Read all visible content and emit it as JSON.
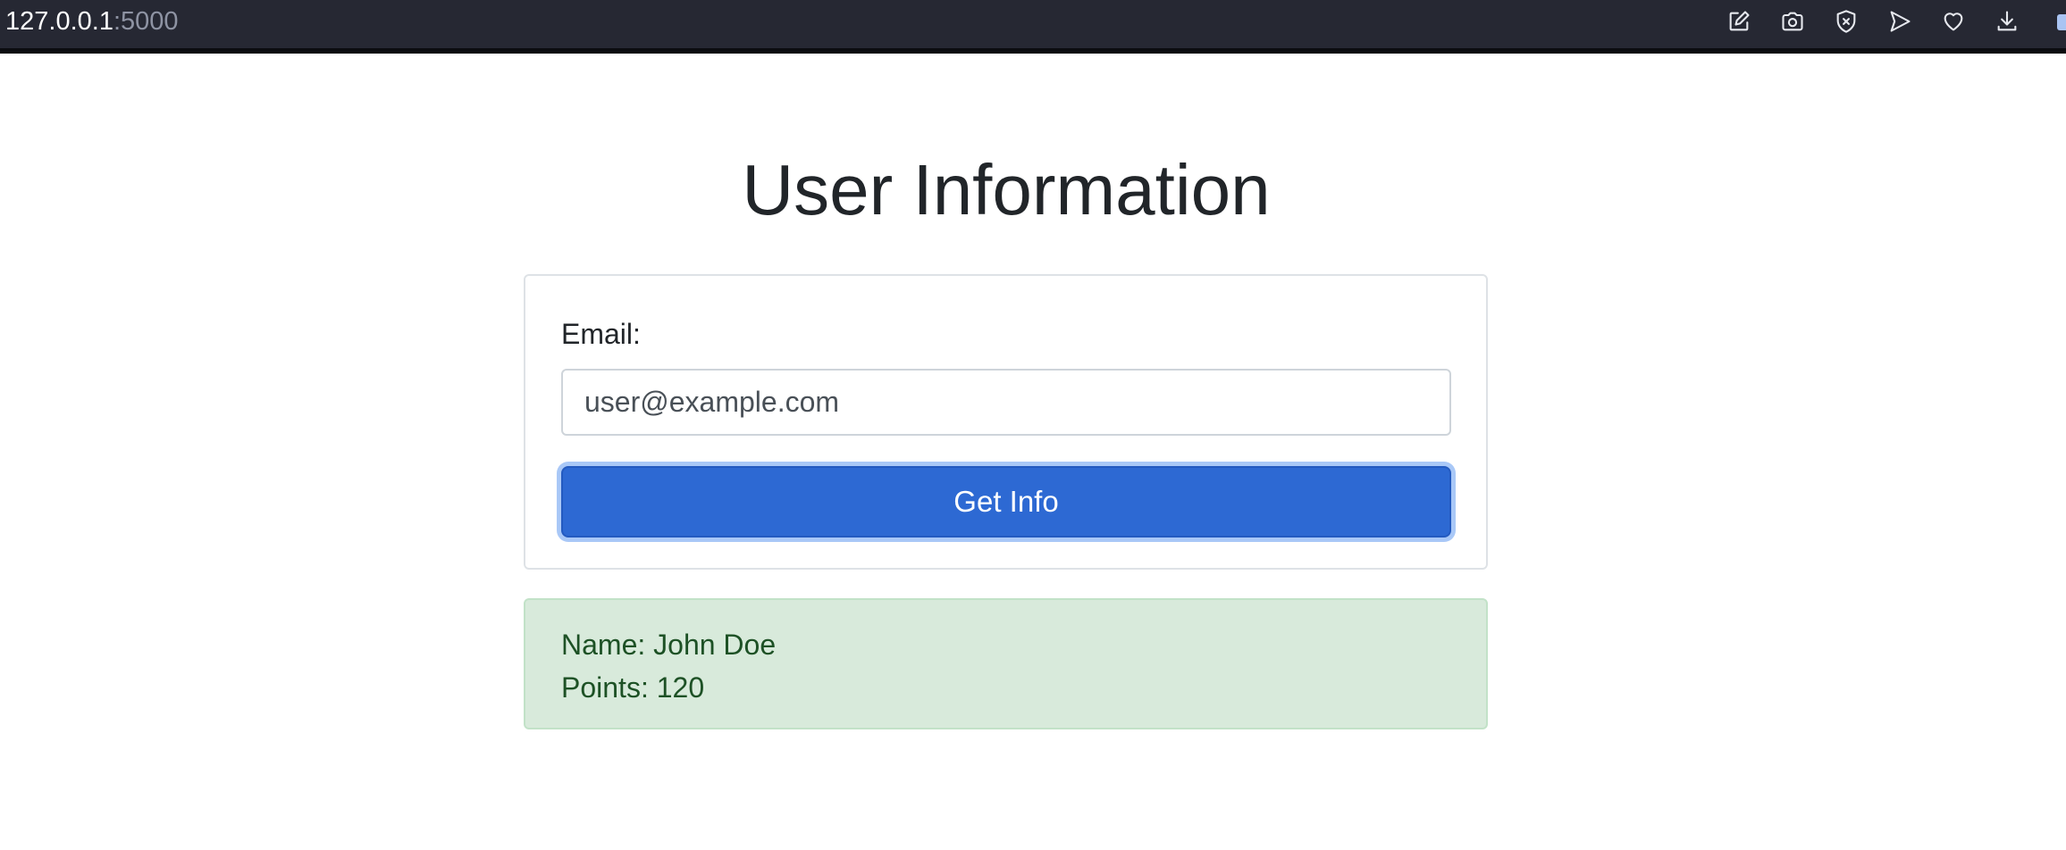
{
  "browser": {
    "address_host": "127.0.0.1",
    "address_port": ":5000",
    "toolbar_icons": [
      "edit-icon",
      "camera-icon",
      "shield-x-icon",
      "send-icon",
      "heart-icon",
      "download-icon"
    ]
  },
  "page": {
    "title": "User Information"
  },
  "form": {
    "email_label": "Email:",
    "email_value": "user@example.com",
    "submit_label": "Get Info"
  },
  "result": {
    "name_line": "Name: John Doe",
    "points_line": "Points: 120"
  },
  "colors": {
    "browser_bar": "#262833",
    "primary_button": "#2d69d3",
    "success_bg": "#d8eadb",
    "success_text": "#1d5125"
  }
}
